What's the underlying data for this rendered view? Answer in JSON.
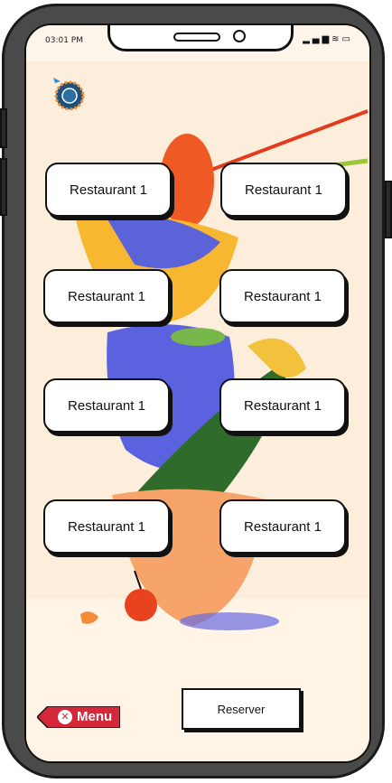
{
  "status_bar": {
    "time": "03:01 PM"
  },
  "restaurants": [
    "Restaurant 1",
    "Restaurant 1",
    "Restaurant 1",
    "Restaurant 1",
    "Restaurant 1",
    "Restaurant 1",
    "Restaurant 1",
    "Restaurant 1"
  ],
  "actions": {
    "reserve_label": "Reserver",
    "menu_label": "Menu"
  },
  "icons": {
    "logo": "globe-plane-logo-icon",
    "menu_close": "close-circle-icon",
    "signal": "signal-icon",
    "wifi": "wifi-icon",
    "battery": "battery-icon"
  },
  "colors": {
    "screen_bg": "#fdeedb",
    "menu_tag": "#d5293b",
    "phone_frame": "#4a4a4a"
  }
}
